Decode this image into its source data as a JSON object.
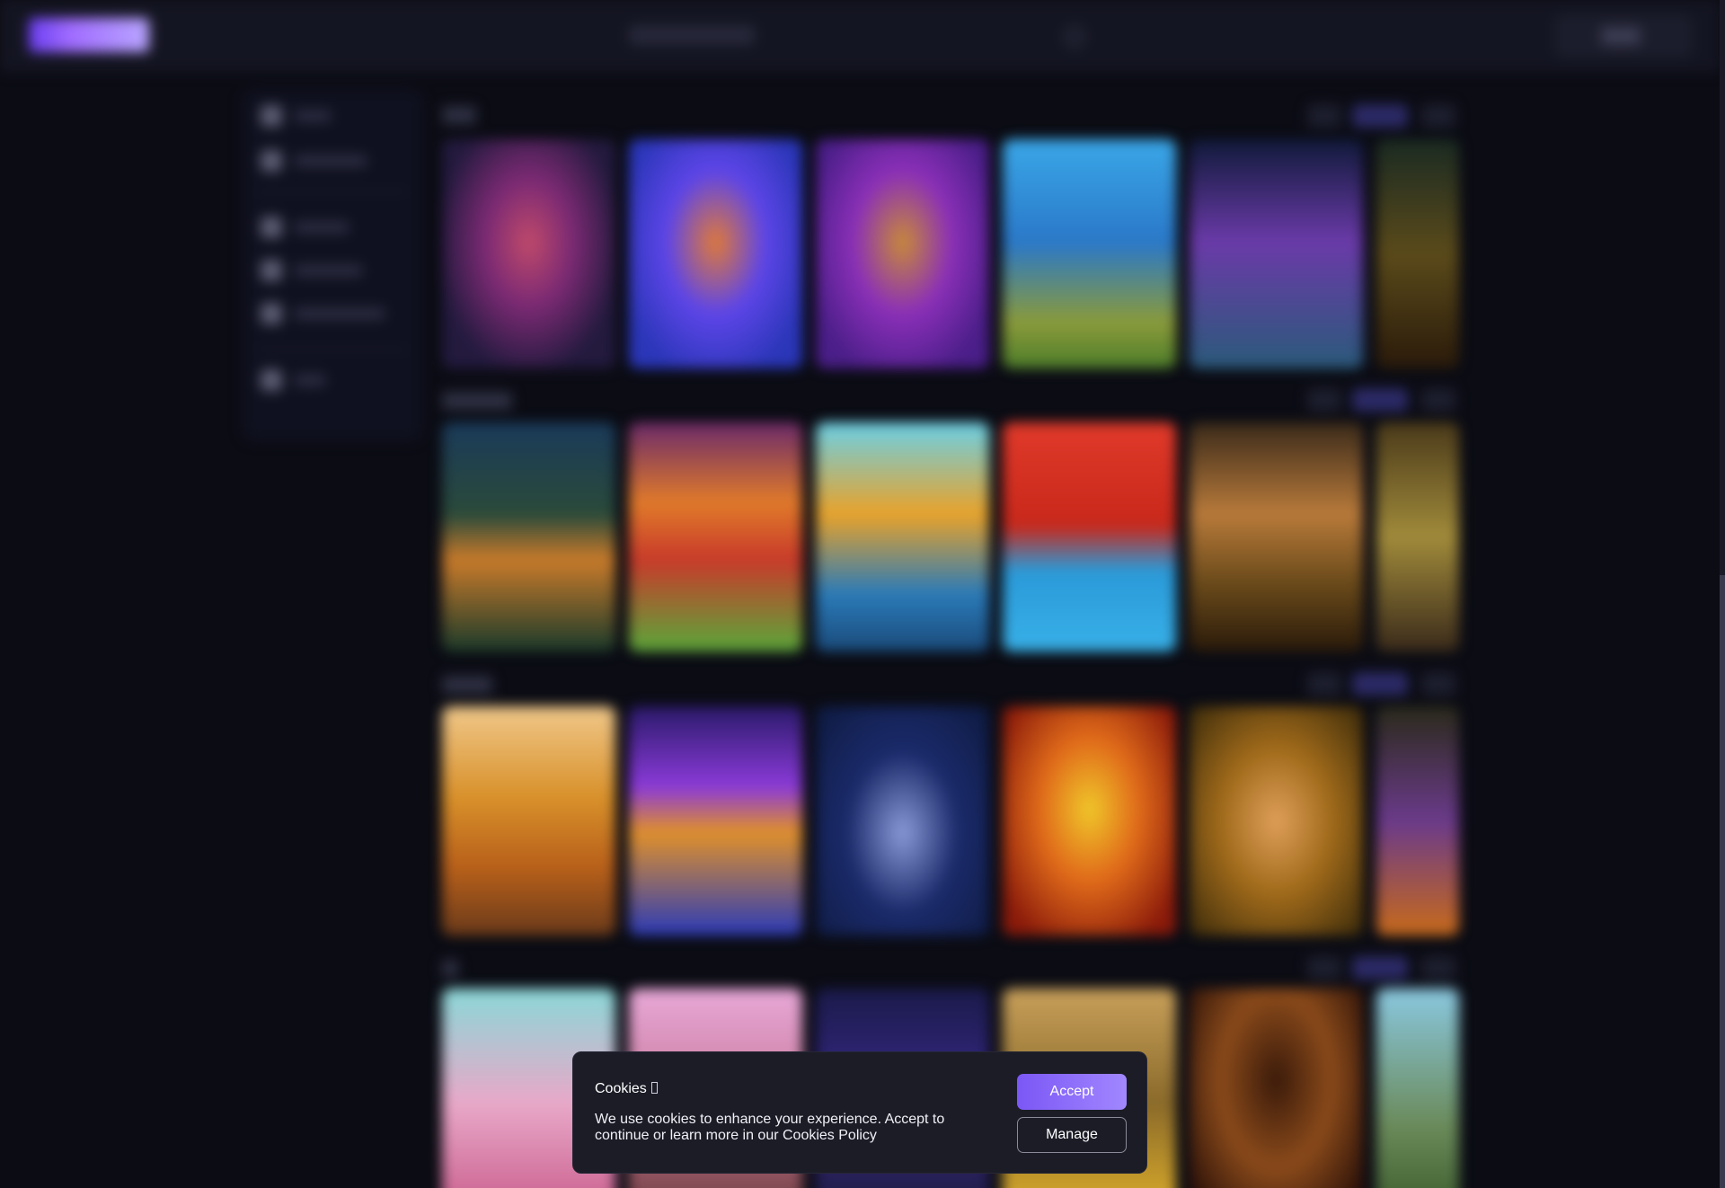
{
  "cookie_dialog": {
    "title": "Cookies",
    "message": "We use cookies to enhance your experience. Accept to continue or learn more in our Cookies Policy",
    "accept_label": "Accept",
    "manage_label": "Manage"
  },
  "colors": {
    "background": "#0b0c14",
    "accent": "#7b57f5",
    "dialog": "#1b1c26"
  },
  "icons": {
    "cookie_title_glyph": "cookie-icon",
    "header_search": "search-icon",
    "sidebar": [
      "home-icon",
      "recent-icon",
      "casino-icon",
      "slots-icon",
      "live-icon",
      "promo-icon"
    ]
  }
}
